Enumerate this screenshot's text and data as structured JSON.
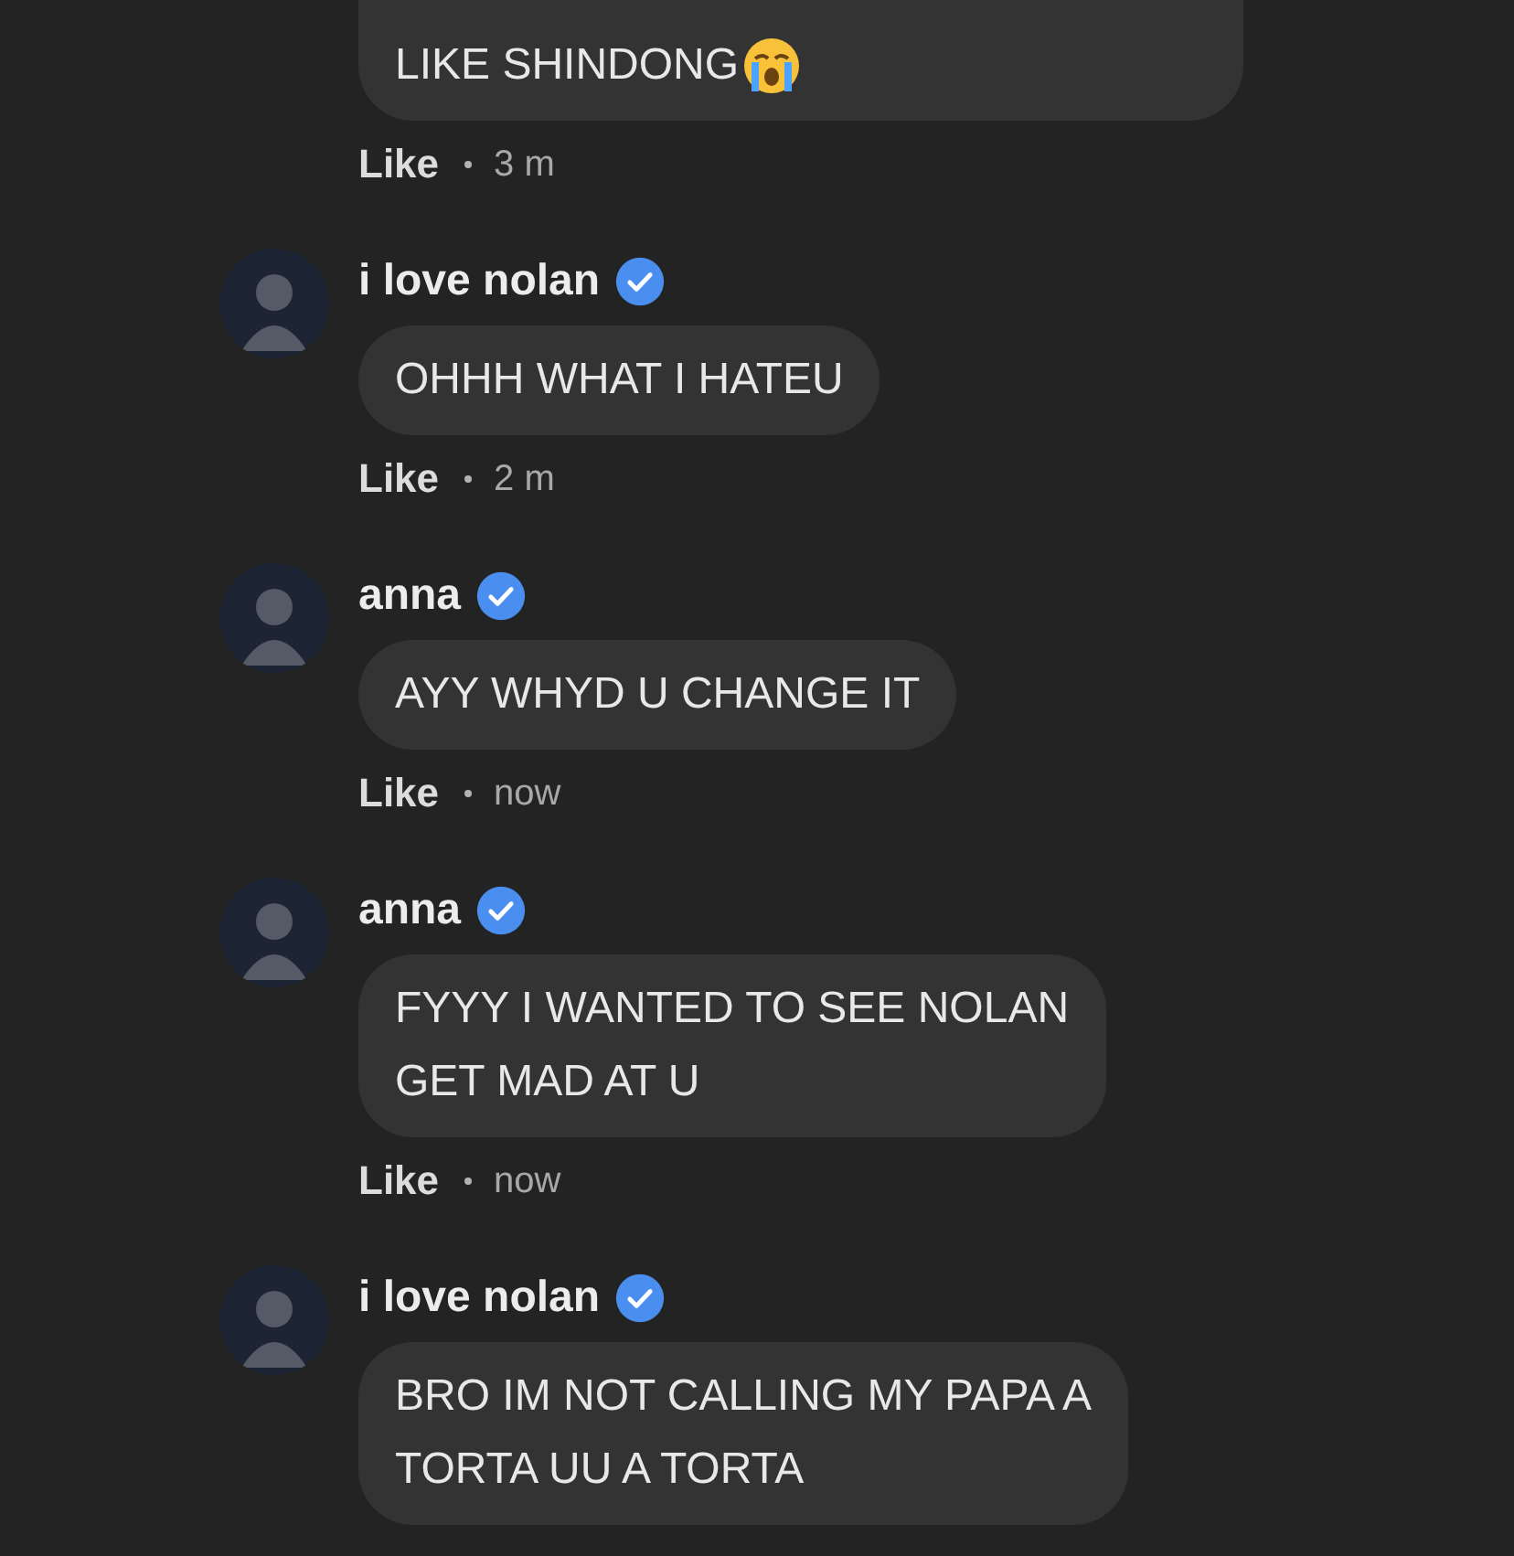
{
  "top_comment": {
    "text": "LIKE SHINDONG",
    "like": "Like",
    "time": "3 m"
  },
  "comments": [
    {
      "name": "i love nolan",
      "verified": true,
      "text": "OHHH WHAT I HATEU",
      "like": "Like",
      "time": "2 m"
    },
    {
      "name": "anna",
      "verified": true,
      "text": "AYY WHYD U CHANGE IT",
      "like": "Like",
      "time": "now"
    },
    {
      "name": "anna",
      "verified": true,
      "text": "FYYY I WANTED TO SEE NOLAN\nGET MAD AT U",
      "like": "Like",
      "time": "now"
    },
    {
      "name": "i love nolan",
      "verified": true,
      "text": "BRO IM NOT CALLING MY PAPA A\nTORTA UU A TORTA"
    }
  ]
}
